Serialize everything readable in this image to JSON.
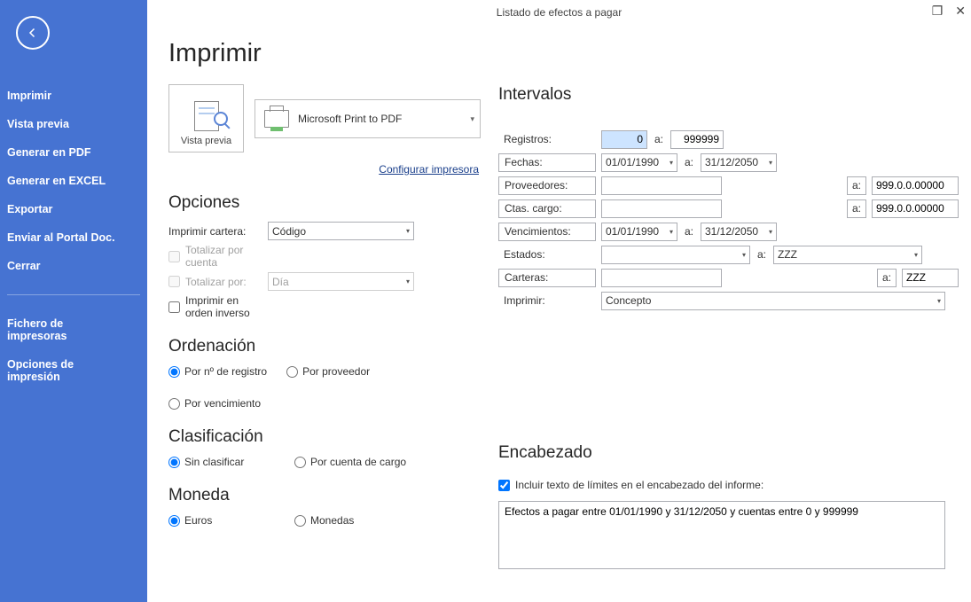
{
  "window": {
    "title": "Listado de efectos a pagar"
  },
  "sidebar": {
    "items": [
      "Imprimir",
      "Vista previa",
      "Generar en PDF",
      "Generar en EXCEL",
      "Exportar",
      "Enviar al Portal Doc.",
      "Cerrar"
    ],
    "items2": [
      "Fichero de impresoras",
      "Opciones de impresión"
    ]
  },
  "main": {
    "heading": "Imprimir",
    "preview_label": "Vista previa",
    "printer": "Microsoft Print to PDF",
    "config_link": "Configurar impresora"
  },
  "opciones": {
    "heading": "Opciones",
    "cartera_label": "Imprimir cartera:",
    "cartera_value": "Código",
    "tot_cuenta": "Totalizar por cuenta",
    "tot_por": "Totalizar por:",
    "tot_por_value": "Día",
    "orden_inverso": "Imprimir en orden inverso"
  },
  "ordenacion": {
    "heading": "Ordenación",
    "r1": "Por nº de registro",
    "r2": "Por proveedor",
    "r3": "Por vencimiento"
  },
  "clasificacion": {
    "heading": "Clasificación",
    "r1": "Sin clasificar",
    "r2": "Por cuenta de cargo"
  },
  "moneda": {
    "heading": "Moneda",
    "r1": "Euros",
    "r2": "Monedas"
  },
  "intervalos": {
    "heading": "Intervalos",
    "sep": "a:",
    "registros_label": "Registros:",
    "registros_from": "0",
    "registros_to": "999999",
    "fechas_label": "Fechas:",
    "fechas_from": "01/01/1990",
    "fechas_to": "31/12/2050",
    "prov_label": "Proveedores:",
    "prov_to": "999.0.0.00000",
    "ctas_label": "Ctas. cargo:",
    "ctas_to": "999.0.0.00000",
    "venc_label": "Vencimientos:",
    "venc_from": "01/01/1990",
    "venc_to": "31/12/2050",
    "estados_label": "Estados:",
    "estados_to": "ZZZ",
    "carteras_label": "Carteras:",
    "carteras_to": "ZZZ",
    "imprimir_label": "Imprimir:",
    "imprimir_value": "Concepto"
  },
  "encabezado": {
    "heading": "Encabezado",
    "check": "Incluir texto de límites en el encabezado del informe:",
    "text": "Efectos a pagar entre 01/01/1990 y 31/12/2050 y cuentas entre 0 y 999999"
  }
}
